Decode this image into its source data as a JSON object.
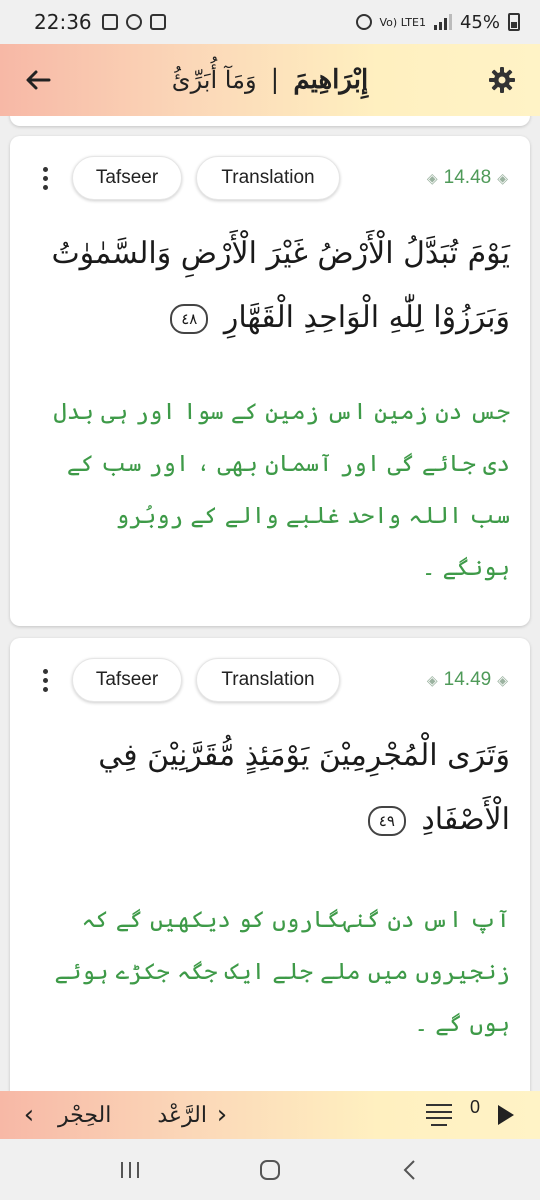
{
  "status_bar": {
    "time": "22:36",
    "network": "Vo) LTE1",
    "battery": "45%"
  },
  "header": {
    "juz_name": "وَمَآ أُبَرِّئُ",
    "separator": "|",
    "surah_name": "إِبْرَاهِيمَ"
  },
  "ayahs": [
    {
      "number": "14.48",
      "tafseer_label": "Tafseer",
      "translation_label": "Translation",
      "arabic": "يَوْمَ تُبَدَّلُ الْأَرْضُ غَيْرَ الْأَرْضِ وَالسَّمٰوٰتُ وَبَرَزُوْا لِلّٰهِ الْوَاحِدِ الْقَهَّارِ",
      "marker": "٤٨",
      "urdu": "جس دن زمین اس زمین کے سوا اور ہی بدل دی جائے گی اور آسمان بھی ، اور سب کے سب اللہ واحد غلبے والے کے روبُرو ہونگے ۔"
    },
    {
      "number": "14.49",
      "tafseer_label": "Tafseer",
      "translation_label": "Translation",
      "arabic": "وَتَرَى الْمُجْرِمِيْنَ يَوْمَئِذٍ مُّقَرَّنِيْنَ فِي الْأَصْفَادِ",
      "marker": "٤٩",
      "urdu": "آپ اس دن گنہگاروں کو دیکھیں گے کہ زنجیروں میں ملے جلے ایک جگہ جکڑے ہوئے ہوں گے ۔"
    }
  ],
  "bottom_bar": {
    "prev_surah": "الحِجْر",
    "next_surah": "الرَّعْد",
    "playlist_count": "0"
  },
  "icons": {
    "back": "arrow-left-icon",
    "settings": "gear-icon",
    "menu": "kebab-icon",
    "play": "play-icon"
  },
  "colors": {
    "urdu_text": "#3e9a48",
    "ayah_number": "#4f9a59"
  }
}
